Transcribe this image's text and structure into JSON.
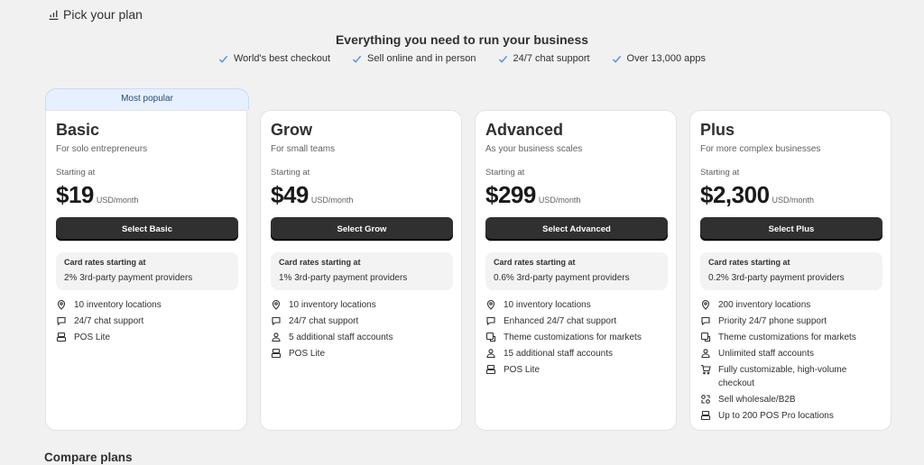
{
  "header": {
    "title": "Pick your plan",
    "icon": "plan-icon"
  },
  "hero": {
    "title": "Everything you need to run your business",
    "benefits": [
      "World's best checkout",
      "Sell online and in person",
      "24/7 chat support",
      "Over 13,000 apps"
    ]
  },
  "popular_label": "Most popular",
  "plans": [
    {
      "name": "Basic",
      "subtitle": "For solo entrepreneurs",
      "starting": "Starting at",
      "price": "$19",
      "period": "USD/month",
      "button": "Select Basic",
      "rates_title": "Card rates starting at",
      "rates_value": "2% 3rd-party payment providers",
      "features": [
        {
          "icon": "location-icon",
          "text": "10 inventory locations"
        },
        {
          "icon": "chat-icon",
          "text": "24/7 chat support"
        },
        {
          "icon": "pos-icon",
          "text": "POS Lite"
        }
      ]
    },
    {
      "name": "Grow",
      "subtitle": "For small teams",
      "starting": "Starting at",
      "price": "$49",
      "period": "USD/month",
      "button": "Select Grow",
      "rates_title": "Card rates starting at",
      "rates_value": "1% 3rd-party payment providers",
      "features": [
        {
          "icon": "location-icon",
          "text": "10 inventory locations"
        },
        {
          "icon": "chat-icon",
          "text": "24/7 chat support"
        },
        {
          "icon": "person-icon",
          "text": "5 additional staff accounts"
        },
        {
          "icon": "pos-icon",
          "text": "POS Lite"
        }
      ]
    },
    {
      "name": "Advanced",
      "subtitle": "As your business scales",
      "starting": "Starting at",
      "price": "$299",
      "period": "USD/month",
      "button": "Select Advanced",
      "rates_title": "Card rates starting at",
      "rates_value": "0.6% 3rd-party payment providers",
      "features": [
        {
          "icon": "location-icon",
          "text": "10 inventory locations"
        },
        {
          "icon": "chat-icon",
          "text": "Enhanced 24/7 chat support"
        },
        {
          "icon": "theme-icon",
          "text": "Theme customizations for markets"
        },
        {
          "icon": "person-icon",
          "text": "15 additional staff accounts"
        },
        {
          "icon": "pos-icon",
          "text": "POS Lite"
        }
      ]
    },
    {
      "name": "Plus",
      "subtitle": "For more complex businesses",
      "starting": "Starting at",
      "price": "$2,300",
      "period": "USD/month",
      "button": "Select Plus",
      "rates_title": "Card rates starting at",
      "rates_value": "0.2% 3rd-party payment providers",
      "features": [
        {
          "icon": "location-icon",
          "text": "200 inventory locations"
        },
        {
          "icon": "chat-icon",
          "text": "Priority 24/7 phone support"
        },
        {
          "icon": "theme-icon",
          "text": "Theme customizations for markets"
        },
        {
          "icon": "person-icon",
          "text": "Unlimited staff accounts"
        },
        {
          "icon": "cart-icon",
          "text": "Fully customizable, high-volume checkout"
        },
        {
          "icon": "wholesale-icon",
          "text": "Sell wholesale/B2B"
        },
        {
          "icon": "pos-icon",
          "text": "Up to 200 POS Pro locations"
        }
      ]
    }
  ],
  "compare_title": "Compare plans"
}
